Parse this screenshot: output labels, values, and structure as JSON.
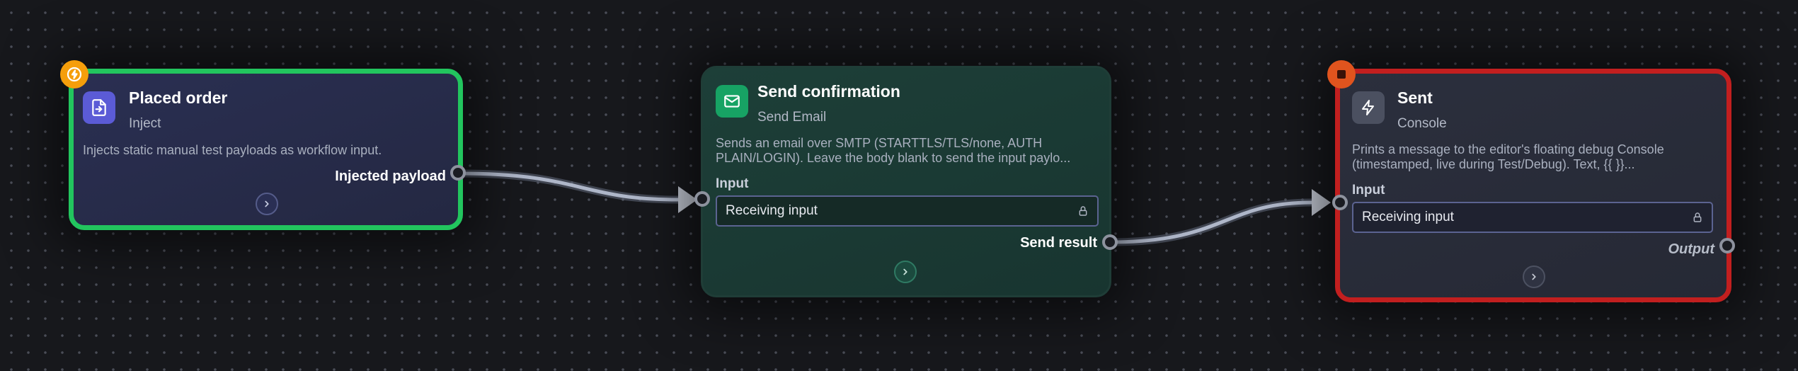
{
  "colors": {
    "canvas": "#17181c",
    "success_border": "#22c55e",
    "error_border": "#c21f1f",
    "trigger_badge": "#f59e0b",
    "stop_badge": "#e0541e",
    "inject_icon_bg": "#5b5bd6",
    "email_icon_bg": "#17a364",
    "console_icon_bg": "#4b5060"
  },
  "nodes": {
    "inject": {
      "title": "Placed order",
      "type": "Inject",
      "description": "Injects static manual test payloads as workflow input.",
      "output_port": "Injected payload",
      "icon": "file-import-icon",
      "badge_icon": "lightning-icon"
    },
    "email": {
      "title": "Send confirmation",
      "type": "Send Email",
      "description": "Sends an email over SMTP (STARTTLS/TLS/none, AUTH\nPLAIN/LOGIN). Leave the body blank to send the input paylo...",
      "input_label": "Input",
      "input_value": "Receiving input",
      "output_port": "Send result",
      "icon": "mail-icon"
    },
    "console": {
      "title": "Sent",
      "type": "Console",
      "description": "Prints a message to the editor's floating debug Console\n(timestamped, live during Test/Debug). Text, {{ }}...",
      "input_label": "Input",
      "input_value": "Receiving input",
      "output_port": "Output",
      "icon": "lightning-icon",
      "badge_icon": "stop-icon"
    }
  }
}
